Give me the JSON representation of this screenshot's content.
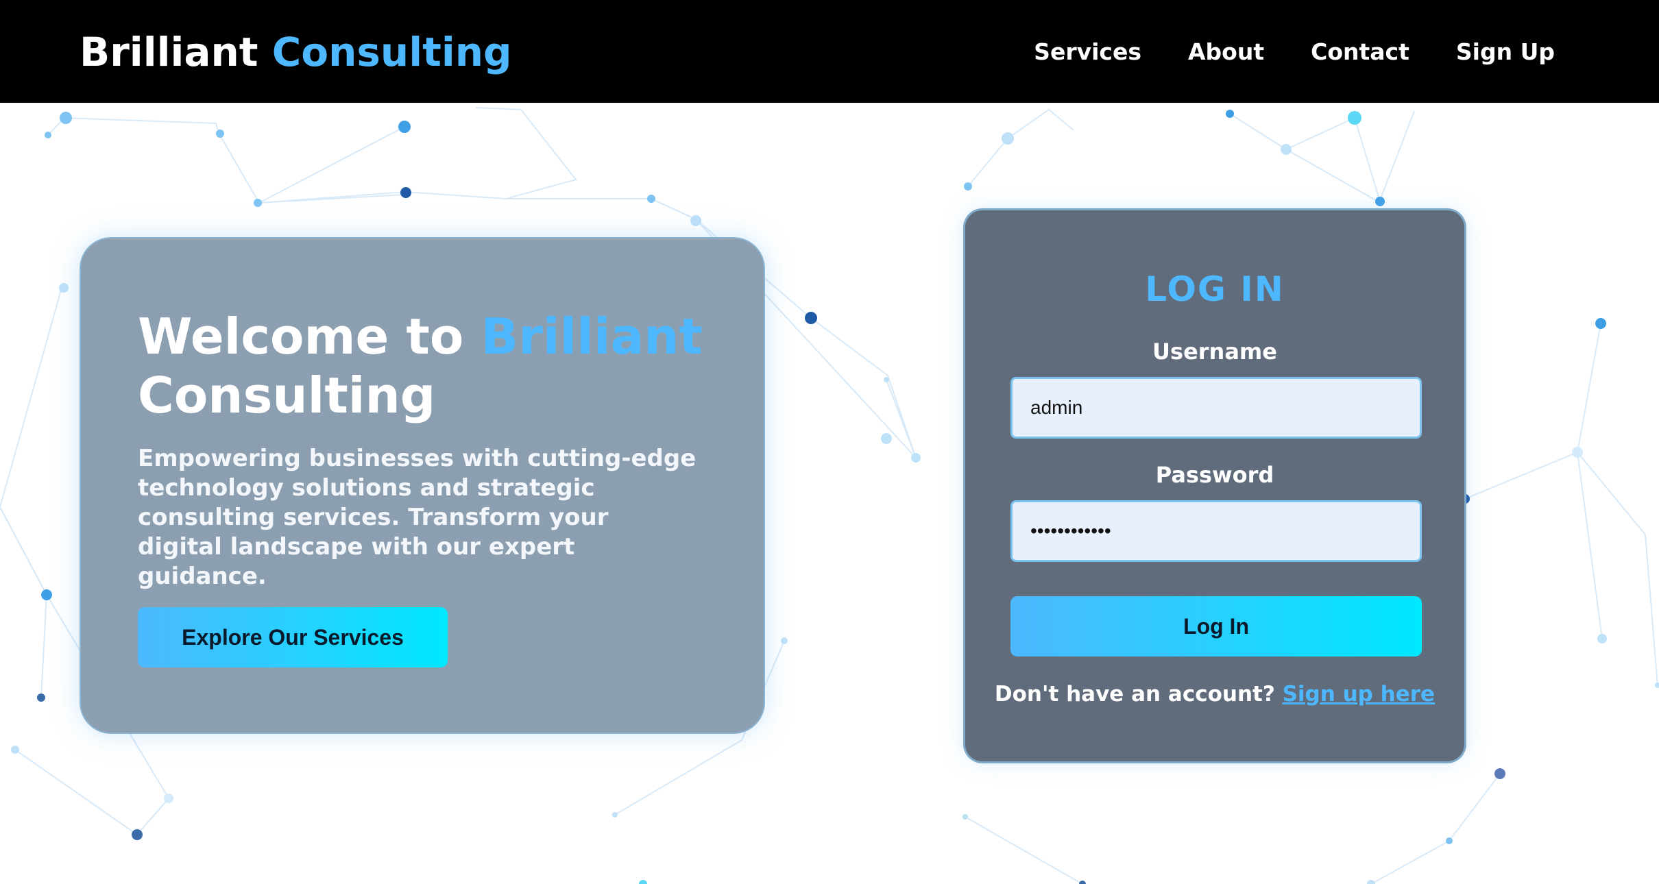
{
  "navbar": {
    "brand_primary": "Brilliant",
    "brand_accent": "Consulting",
    "links": [
      {
        "label": "Services"
      },
      {
        "label": "About"
      },
      {
        "label": "Contact"
      },
      {
        "label": "Sign Up"
      }
    ]
  },
  "welcome": {
    "title_prefix": "Welcome to",
    "title_accent": "Brilliant",
    "title_suffix": "Consulting",
    "description": "Empowering businesses with cutting-edge technology solutions and strategic consulting services. Transform your digital landscape with our expert guidance.",
    "cta_label": "Explore Our Services"
  },
  "login": {
    "title": "LOG IN",
    "username_label": "Username",
    "username_value": "admin",
    "password_label": "Password",
    "password_value": "password1234",
    "submit_label": "Log In",
    "signup_prompt": "Don't have an account?",
    "signup_link": "Sign up here"
  },
  "colors": {
    "accent": "#4db8ff",
    "navbar_bg": "#000000",
    "button_gradient_start": "#4db8ff",
    "button_gradient_end": "#00e8ff",
    "welcome_card_bg": "#8a9dae",
    "login_card_bg": "#5e6a7a",
    "input_bg": "#e8f0fe"
  }
}
